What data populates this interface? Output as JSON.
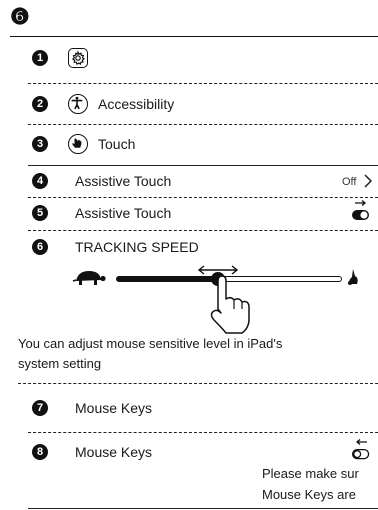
{
  "header": {
    "step_number": "❻"
  },
  "steps": [
    {
      "num": "1",
      "label": ""
    },
    {
      "num": "2",
      "label": "Accessibility"
    },
    {
      "num": "3",
      "label": "Touch"
    },
    {
      "num": "4",
      "label": "Assistive Touch",
      "value": "Off"
    },
    {
      "num": "5",
      "label": "Assistive Touch"
    },
    {
      "num": "6",
      "label": "TRACKING SPEED"
    },
    {
      "num": "7",
      "label": "Mouse Keys"
    },
    {
      "num": "8",
      "label": "Mouse Keys"
    }
  ],
  "tracking_note": [
    "You can adjust mouse sensitive level in iPad's",
    "system setting"
  ],
  "mouse_keys_note": [
    "Please make sur",
    "Mouse Keys are"
  ],
  "tracking_speed": {
    "level": 0.45
  },
  "icons": {
    "settings": "gear-icon",
    "accessibility": "accessibility-icon",
    "touch": "touch-hand-icon",
    "chevron": "chevron-right-icon",
    "toggle": "toggle-icon",
    "slow": "turtle-icon",
    "fast": "rabbit-icon",
    "drag": "pointing-hand-icon"
  }
}
